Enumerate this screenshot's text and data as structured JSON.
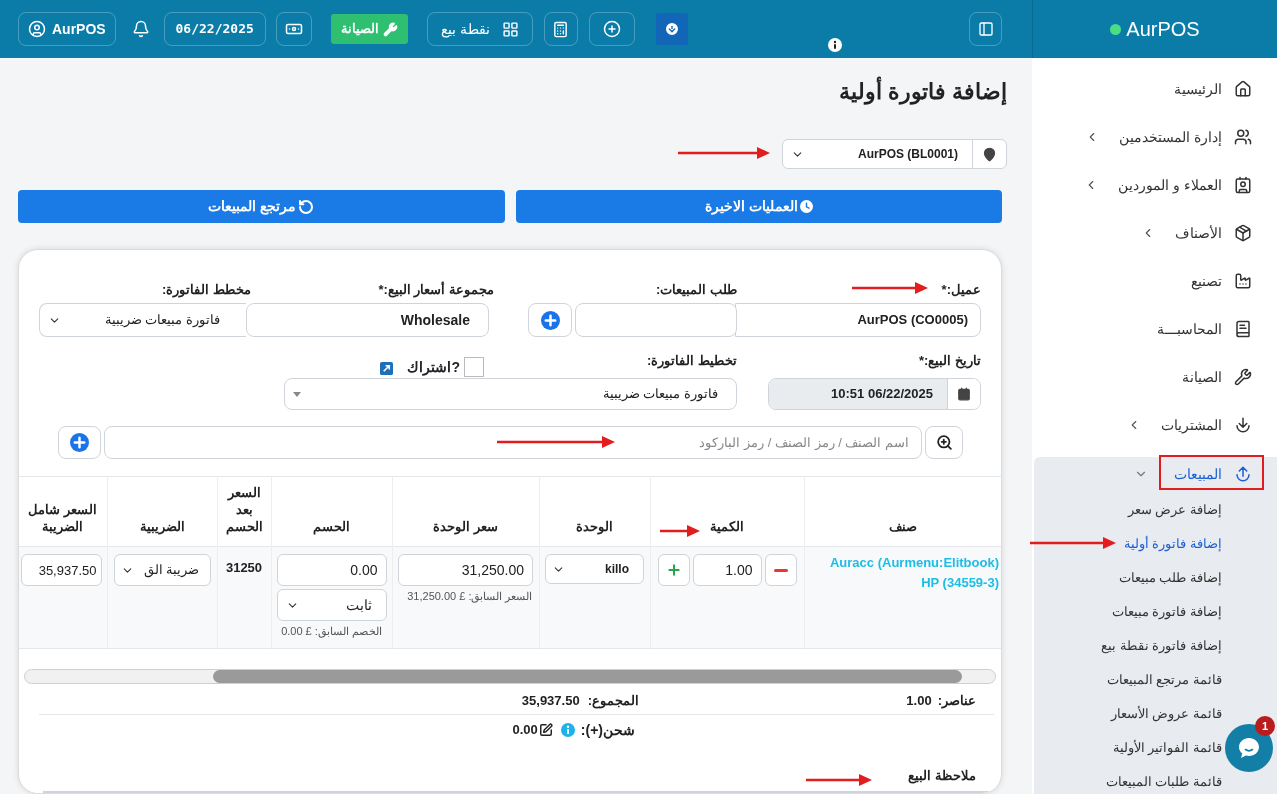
{
  "topbar": {
    "user": "AurPOS",
    "date": "06/22/2025",
    "maintenance": "الصيانة",
    "pos": "نقطة بيع"
  },
  "sidebar": {
    "brand": "AurPOS",
    "items": [
      {
        "label": "الرئيسية",
        "has_submenu": false,
        "expanded": false,
        "selected": false
      },
      {
        "label": "إدارة المستخدمين",
        "has_submenu": true,
        "expanded": false,
        "selected": false
      },
      {
        "label": "العملاء و الموردين",
        "has_submenu": true,
        "expanded": false,
        "selected": false
      },
      {
        "label": "الأصناف",
        "has_submenu": true,
        "expanded": false,
        "selected": false
      },
      {
        "label": "تصنيع",
        "has_submenu": false,
        "expanded": false,
        "selected": false
      },
      {
        "label": "المحاسبـــة",
        "has_submenu": false,
        "expanded": false,
        "selected": false
      },
      {
        "label": "الصيانة",
        "has_submenu": false,
        "expanded": false,
        "selected": false
      },
      {
        "label": "المشتريات",
        "has_submenu": true,
        "expanded": false,
        "selected": false
      },
      {
        "label": "المبيعات",
        "has_submenu": true,
        "expanded": true,
        "selected": true,
        "children": [
          {
            "label": "إضافة عرض سعر",
            "selected": false
          },
          {
            "label": "إضافة فاتورة أولية",
            "selected": true
          },
          {
            "label": "إضافة طلب مبيعات",
            "selected": false
          },
          {
            "label": "إضافة فاتورة مبيعات",
            "selected": false
          },
          {
            "label": "إضافة فاتورة نقطة بيع",
            "selected": false
          },
          {
            "label": "قائمة مرتجع المبيعات",
            "selected": false
          },
          {
            "label": "قائمة عروض الأسعار",
            "selected": false
          },
          {
            "label": "قائمة الفواتير الأولية",
            "selected": false
          },
          {
            "label": "قائمة طلبات المبيعات",
            "selected": false
          }
        ]
      }
    ]
  },
  "page": {
    "title": "إضافة فاتورة أولية",
    "location": "AurPOS (BL0001)",
    "actions": [
      {
        "label": "العمليات الاخيرة",
        "kind": "recent"
      },
      {
        "label": "مرتجع المبيعات",
        "kind": "return"
      }
    ]
  },
  "form": {
    "customer": {
      "label": "عميل:*",
      "value": "AurPOS (CO0005)"
    },
    "sales_order": {
      "label": "طلب المبيعات:"
    },
    "price_group": {
      "label": "مجموعة أسعار البيع:*",
      "value": "Wholesale"
    },
    "invoice_schema": {
      "label": "مخطط الفاتورة:",
      "value": "فاتورة مبيعات ضريبية"
    },
    "sale_date": {
      "label": "تاريخ البيع:*",
      "value": "10:51 06/22/2025"
    },
    "invoice_layout": {
      "label": "تخطيط الفاتورة:",
      "value": "فاتورة مبيعات ضريبية"
    },
    "subscription": {
      "label": "اشتراك?",
      "checked": false
    },
    "search": {
      "placeholder": "اسم الصنف / رمز الصنف / رمز الباركود"
    }
  },
  "items_table": {
    "columns": [
      "صنف",
      "الكمية",
      "الوحدة",
      "سعر الوحدة",
      "الحسم",
      "السعر بعد الحسم",
      "الضريبية",
      "السعر شامل الضريبة"
    ],
    "rows": [
      {
        "product": "Auracc (Aurmenu:Elitbook) HP (34559-3)",
        "quantity": "1.00",
        "unit": "killo",
        "unit_price": "31,250.00",
        "previous_price": "السعر السابق: £ 31,250.00",
        "discount": "0.00",
        "discount_type": "ثابت",
        "previous_discount": "الخصم السابق: £ 0.00",
        "price_after_discount": "31250",
        "tax": "ضريبة الق",
        "total": "35,937.50"
      }
    ]
  },
  "summary": {
    "items_label": "عناصر:",
    "items_value": "1.00",
    "total_label": "المجموع:",
    "total_value": "35,937.50",
    "shipping_label": "شحن(+):",
    "shipping_value": "0.00"
  },
  "note": {
    "label": "ملاحظة البيع"
  },
  "chat": {
    "badge": "1"
  }
}
